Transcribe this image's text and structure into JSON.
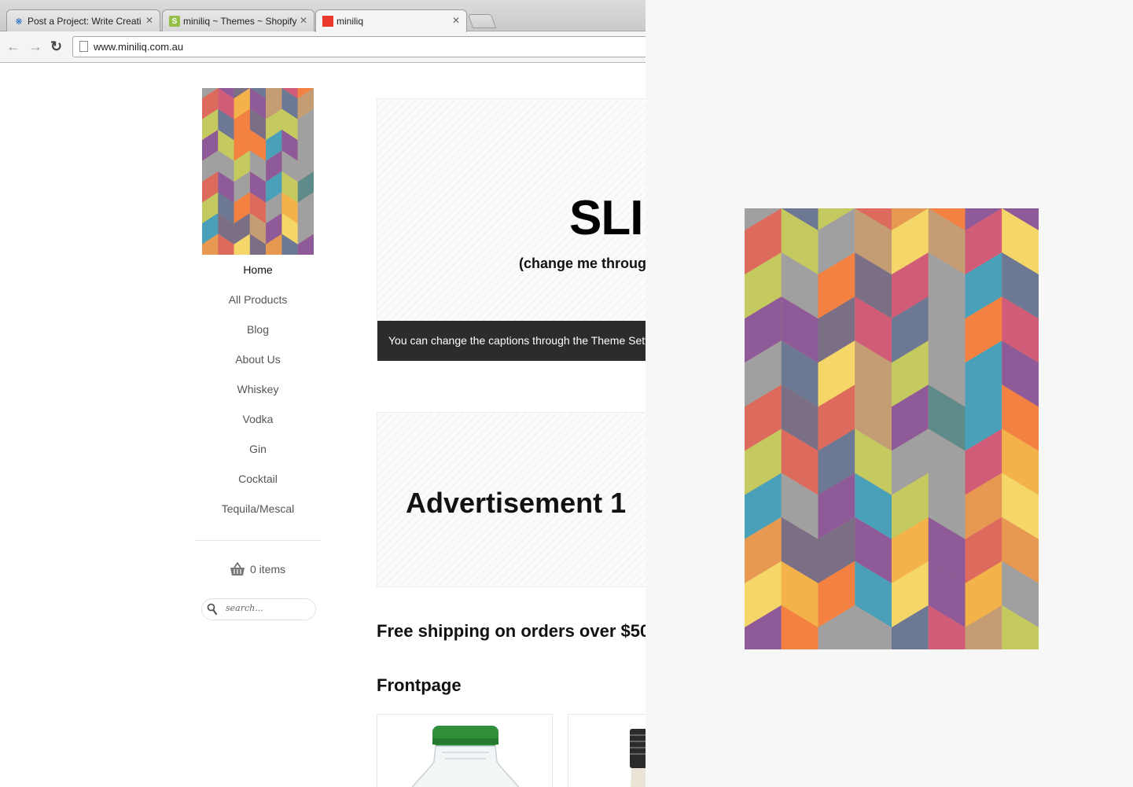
{
  "browser": {
    "tabs": [
      {
        "title": "Post a Project: Write Creati",
        "favicon": "freelancer-icon",
        "active": false
      },
      {
        "title": "miniliq ~ Themes ~ Shopify",
        "favicon": "shopify-icon",
        "active": false
      },
      {
        "title": "miniliq",
        "favicon": "red-square-icon",
        "active": true
      }
    ],
    "url": "www.miniliq.com.au"
  },
  "sidebar": {
    "nav": [
      {
        "label": "Home",
        "active": true
      },
      {
        "label": "All Products"
      },
      {
        "label": "Blog"
      },
      {
        "label": "About Us"
      },
      {
        "label": "Whiskey"
      },
      {
        "label": "Vodka"
      },
      {
        "label": "Gin"
      },
      {
        "label": "Cocktail"
      },
      {
        "label": "Tequila/Mescal"
      }
    ],
    "cart": {
      "label": "0 items"
    },
    "search": {
      "placeholder": "search..."
    }
  },
  "main": {
    "slider": {
      "title": "SLIDE",
      "subtitle": "(change me through the Theme Settings)",
      "caption": "You can change the captions through the Theme Settings"
    },
    "ad1": {
      "label": "Advertisement 1"
    },
    "shipping": "Free shipping on orders over $50",
    "frontpage_title": "Frontpage"
  },
  "colors": {
    "caption_bg": "#2c2c2c",
    "active_tab_favicon": "#e8392a",
    "pattern_palette": [
      "#f4b24a",
      "#c4c960",
      "#7b6f86",
      "#8f5a98",
      "#c49d74",
      "#f4d768",
      "#a1a0a1",
      "#dc6a5d",
      "#e79952",
      "#6c7894",
      "#d15c77",
      "#5f8a8a",
      "#4aa0b9",
      "#f38142"
    ]
  }
}
